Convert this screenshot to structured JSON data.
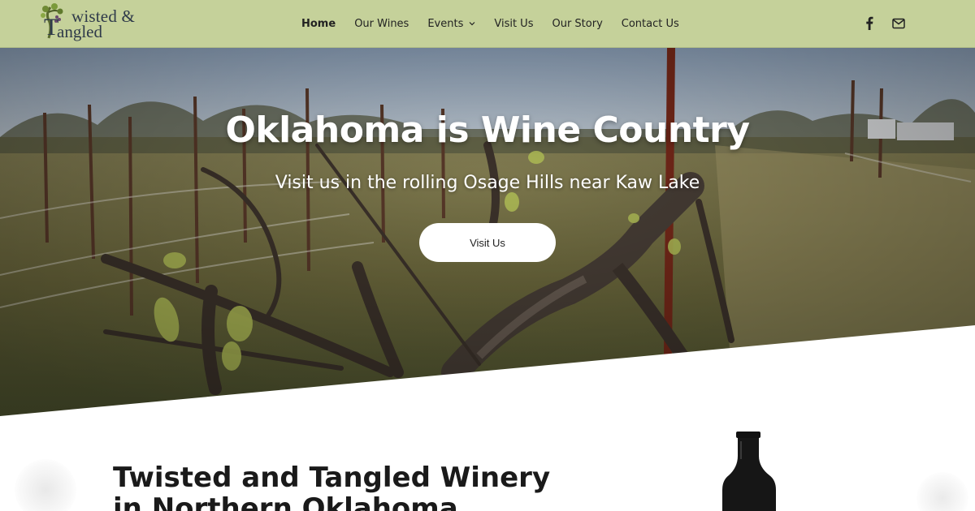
{
  "brand": {
    "logo_line1": "wisted &",
    "logo_line2": "angled",
    "logo_initial": "T"
  },
  "nav": {
    "items": [
      {
        "label": "Home",
        "active": true
      },
      {
        "label": "Our Wines"
      },
      {
        "label": "Events",
        "dropdown": true
      },
      {
        "label": "Visit Us"
      },
      {
        "label": "Our Story"
      },
      {
        "label": "Contact Us"
      }
    ],
    "social_icons": [
      "facebook-icon",
      "mail-icon"
    ]
  },
  "hero": {
    "title": "Oklahoma is Wine Country",
    "subtitle": "Visit us in the rolling Osage Hills near Kaw Lake",
    "button_label": "Visit Us"
  },
  "intro": {
    "heading_line1": "Twisted and Tangled Winery",
    "heading_line2": "in Northern Oklahoma"
  },
  "colors": {
    "header_bg": "#c5d19a",
    "text_dark": "#222222",
    "hero_text": "#ffffff"
  }
}
